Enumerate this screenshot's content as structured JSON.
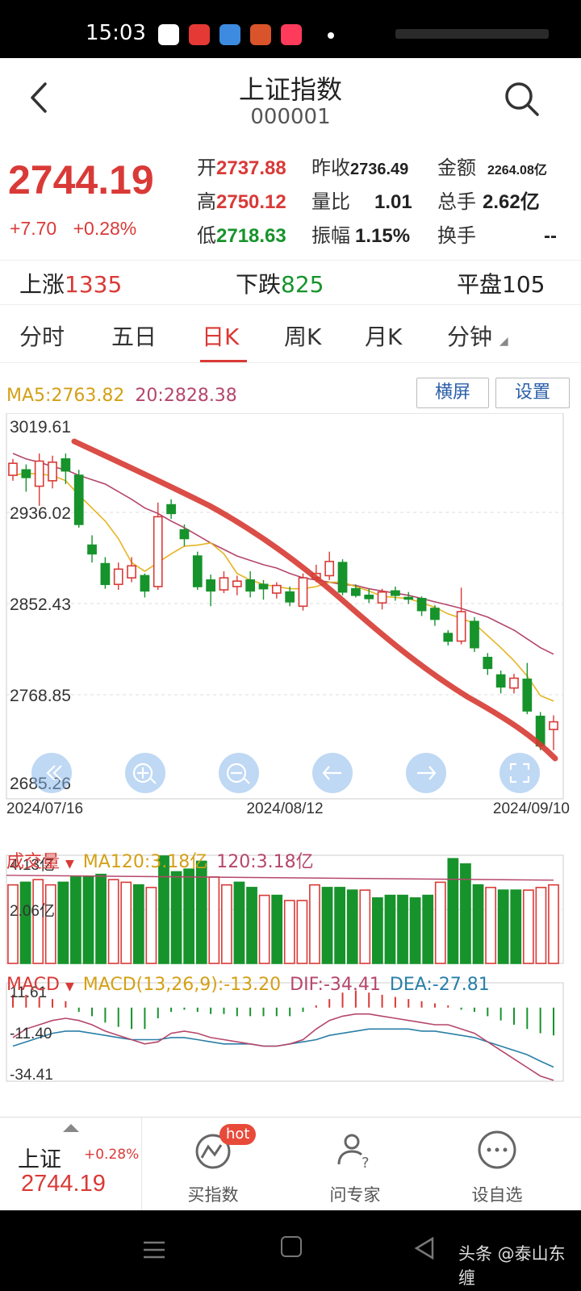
{
  "status_bar": {
    "time": "15:03"
  },
  "header": {
    "title": "上证指数",
    "code": "000001"
  },
  "quote": {
    "price": "2744.19",
    "change": "+7.70",
    "change_pct": "+0.28%",
    "open_label": "开",
    "open": "2737.88",
    "prev_close_label": "昨收",
    "prev_close": "2736.49",
    "amount_label": "金额",
    "amount": "2264.08亿",
    "high_label": "高",
    "high": "2750.12",
    "vol_ratio_label": "量比",
    "vol_ratio": "1.01",
    "total_vol_label": "总手",
    "total_vol": "2.62亿",
    "low_label": "低",
    "low": "2718.63",
    "amplitude_label": "振幅",
    "amplitude": "1.15%",
    "turnover_label": "换手",
    "turnover": "--"
  },
  "breadth": {
    "up_label": "上涨",
    "up": "1335",
    "down_label": "下跌",
    "down": "825",
    "flat_label": "平盘",
    "flat": "105"
  },
  "tabs": [
    "分时",
    "五日",
    "日K",
    "周K",
    "月K",
    "分钟"
  ],
  "active_tab": "日K",
  "kline": {
    "ma5_label": "MA5:2763.82",
    "ma20_label": "20:2828.38",
    "landscape_btn": "横屏",
    "settings_btn": "设置",
    "y_ticks": [
      "3019.61",
      "2936.02",
      "2852.43",
      "2768.85",
      "2685.26"
    ],
    "x_ticks": [
      "2024/07/16",
      "2024/08/12",
      "2024/09/10"
    ]
  },
  "volume": {
    "title": "成交量",
    "ma120_label": "MA120:3.18亿",
    "label_120": "120:3.18亿",
    "y_ticks": [
      "4.13亿",
      "2.06亿"
    ]
  },
  "macd": {
    "title": "MACD",
    "params": "MACD(13,26,9):-13.20",
    "dif": "DIF:-34.41",
    "dea": "DEA:-27.81",
    "y_ticks": [
      "11.61",
      "-11.40",
      "-34.41"
    ]
  },
  "colors": {
    "up": "#d93a37",
    "down": "#17932c",
    "ma5": "#e6b422",
    "ma20": "#b5476a",
    "dif": "#b5476a",
    "dea": "#2a7fa8"
  },
  "chart_data": {
    "type": "candlestick",
    "x_range": [
      "2024/07/16",
      "2024/09/10"
    ],
    "ylim": [
      2685.26,
      3019.61
    ],
    "candles": [
      {
        "o": 2970,
        "c": 2981,
        "h": 2985,
        "l": 2965
      },
      {
        "o": 2975,
        "c": 2968,
        "h": 2980,
        "l": 2955
      },
      {
        "o": 2960,
        "c": 2983,
        "h": 2990,
        "l": 2942
      },
      {
        "o": 2965,
        "c": 2982,
        "h": 2988,
        "l": 2958
      },
      {
        "o": 2985,
        "c": 2974,
        "h": 2990,
        "l": 2962
      },
      {
        "o": 2970,
        "c": 2925,
        "h": 2975,
        "l": 2922
      },
      {
        "o": 2906,
        "c": 2898,
        "h": 2915,
        "l": 2890
      },
      {
        "o": 2889,
        "c": 2870,
        "h": 2895,
        "l": 2866
      },
      {
        "o": 2870,
        "c": 2884,
        "h": 2890,
        "l": 2865
      },
      {
        "o": 2876,
        "c": 2887,
        "h": 2895,
        "l": 2872
      },
      {
        "o": 2878,
        "c": 2864,
        "h": 2880,
        "l": 2858
      },
      {
        "o": 2868,
        "c": 2932,
        "h": 2945,
        "l": 2865
      },
      {
        "o": 2943,
        "c": 2935,
        "h": 2948,
        "l": 2930
      },
      {
        "o": 2920,
        "c": 2912,
        "h": 2925,
        "l": 2905
      },
      {
        "o": 2896,
        "c": 2868,
        "h": 2900,
        "l": 2865
      },
      {
        "o": 2874,
        "c": 2864,
        "h": 2879,
        "l": 2850
      },
      {
        "o": 2865,
        "c": 2876,
        "h": 2882,
        "l": 2862
      },
      {
        "o": 2868,
        "c": 2873,
        "h": 2878,
        "l": 2860
      },
      {
        "o": 2874,
        "c": 2864,
        "h": 2882,
        "l": 2858
      },
      {
        "o": 2870,
        "c": 2866,
        "h": 2874,
        "l": 2856
      },
      {
        "o": 2862,
        "c": 2869,
        "h": 2872,
        "l": 2857
      },
      {
        "o": 2863,
        "c": 2854,
        "h": 2868,
        "l": 2850
      },
      {
        "o": 2850,
        "c": 2876,
        "h": 2880,
        "l": 2846
      },
      {
        "o": 2876,
        "c": 2880,
        "h": 2888,
        "l": 2872
      },
      {
        "o": 2878,
        "c": 2891,
        "h": 2900,
        "l": 2874
      },
      {
        "o": 2890,
        "c": 2863,
        "h": 2893,
        "l": 2860
      },
      {
        "o": 2866,
        "c": 2860,
        "h": 2870,
        "l": 2858
      },
      {
        "o": 2860,
        "c": 2857,
        "h": 2866,
        "l": 2853
      },
      {
        "o": 2853,
        "c": 2863,
        "h": 2866,
        "l": 2847
      },
      {
        "o": 2864,
        "c": 2860,
        "h": 2868,
        "l": 2855
      },
      {
        "o": 2858,
        "c": 2857,
        "h": 2863,
        "l": 2852
      },
      {
        "o": 2857,
        "c": 2846,
        "h": 2859,
        "l": 2841
      },
      {
        "o": 2848,
        "c": 2838,
        "h": 2851,
        "l": 2832
      },
      {
        "o": 2825,
        "c": 2818,
        "h": 2828,
        "l": 2814
      },
      {
        "o": 2818,
        "c": 2845,
        "h": 2867,
        "l": 2815
      },
      {
        "o": 2836,
        "c": 2812,
        "h": 2840,
        "l": 2808
      },
      {
        "o": 2803,
        "c": 2793,
        "h": 2807,
        "l": 2787
      },
      {
        "o": 2787,
        "c": 2776,
        "h": 2791,
        "l": 2770
      },
      {
        "o": 2775,
        "c": 2784,
        "h": 2788,
        "l": 2770
      },
      {
        "o": 2783,
        "c": 2754,
        "h": 2798,
        "l": 2751
      },
      {
        "o": 2749,
        "c": 2722,
        "h": 2753,
        "l": 2718
      },
      {
        "o": 2737,
        "c": 2744,
        "h": 2750,
        "l": 2718
      }
    ],
    "ma5": [
      2970,
      2972,
      2971,
      2970,
      2965,
      2952,
      2940,
      2928,
      2912,
      2890,
      2882,
      2890,
      2898,
      2905,
      2906,
      2908,
      2898,
      2880,
      2874,
      2870,
      2868,
      2866,
      2866,
      2868,
      2872,
      2872,
      2868,
      2864,
      2859,
      2858,
      2857,
      2853,
      2849,
      2843,
      2839,
      2834,
      2823,
      2812,
      2800,
      2786,
      2768,
      2763
    ],
    "ma20": [
      2990,
      2985,
      2982,
      2978,
      2975,
      2970,
      2966,
      2962,
      2955,
      2948,
      2940,
      2935,
      2928,
      2922,
      2915,
      2908,
      2902,
      2896,
      2892,
      2888,
      2885,
      2880,
      2876,
      2874,
      2872,
      2870,
      2869,
      2866,
      2864,
      2862,
      2860,
      2857,
      2854,
      2851,
      2848,
      2844,
      2840,
      2834,
      2828,
      2820,
      2812,
      2806
    ],
    "volume_ylim": [
      0,
      4.13
    ],
    "volume": [
      3.0,
      3.1,
      3.2,
      3.0,
      3.1,
      3.3,
      3.3,
      3.4,
      3.2,
      3.1,
      3.0,
      2.9,
      4.1,
      3.5,
      3.6,
      3.9,
      3.3,
      3.0,
      3.1,
      2.9,
      2.6,
      2.6,
      2.4,
      2.4,
      3.0,
      2.9,
      2.9,
      2.8,
      2.8,
      2.5,
      2.6,
      2.6,
      2.5,
      2.6,
      3.1,
      4.0,
      3.8,
      3.0,
      2.9,
      2.8,
      2.8,
      2.8,
      2.9,
      3.0
    ],
    "macd_ylim": [
      -34.41,
      11.61
    ],
    "macd_hist": [
      6,
      6,
      5,
      4,
      3,
      -2,
      -4,
      -7,
      -9,
      -10,
      -10,
      -5,
      -2,
      -1,
      -2,
      -3,
      -3,
      -4,
      -4,
      -4,
      -4,
      -4,
      -2,
      1,
      4,
      7,
      8,
      7,
      6,
      5,
      4,
      3,
      2,
      1,
      -1,
      -2,
      -4,
      -6,
      -8,
      -10,
      -12,
      -13
    ],
    "dif": [
      -14,
      -10,
      -8,
      -6,
      -5,
      -6,
      -8,
      -11,
      -13,
      -15,
      -17,
      -16,
      -12,
      -11,
      -12,
      -14,
      -15,
      -16,
      -17,
      -18,
      -18,
      -17,
      -15,
      -10,
      -6,
      -4,
      -3,
      -3,
      -4,
      -5,
      -6,
      -7,
      -8,
      -8,
      -10,
      -12,
      -16,
      -20,
      -24,
      -28,
      -32,
      -34
    ],
    "dea": [
      -18,
      -16,
      -14,
      -12,
      -11,
      -11,
      -12,
      -13,
      -14,
      -15,
      -15,
      -15,
      -14,
      -14,
      -15,
      -16,
      -17,
      -17,
      -17,
      -18,
      -18,
      -17,
      -16,
      -15,
      -13,
      -12,
      -11,
      -10,
      -10,
      -10,
      -10,
      -11,
      -11,
      -12,
      -13,
      -14,
      -16,
      -18,
      -20,
      -22,
      -25,
      -27.81
    ]
  },
  "bottom_bar": {
    "index_name": "上证",
    "index_pct": "+0.28%",
    "index_price": "2744.19",
    "items": [
      {
        "label": "买指数",
        "badge": "hot"
      },
      {
        "label": "问专家"
      },
      {
        "label": "设自选"
      }
    ]
  },
  "watermark": "头条 @泰山东缠"
}
